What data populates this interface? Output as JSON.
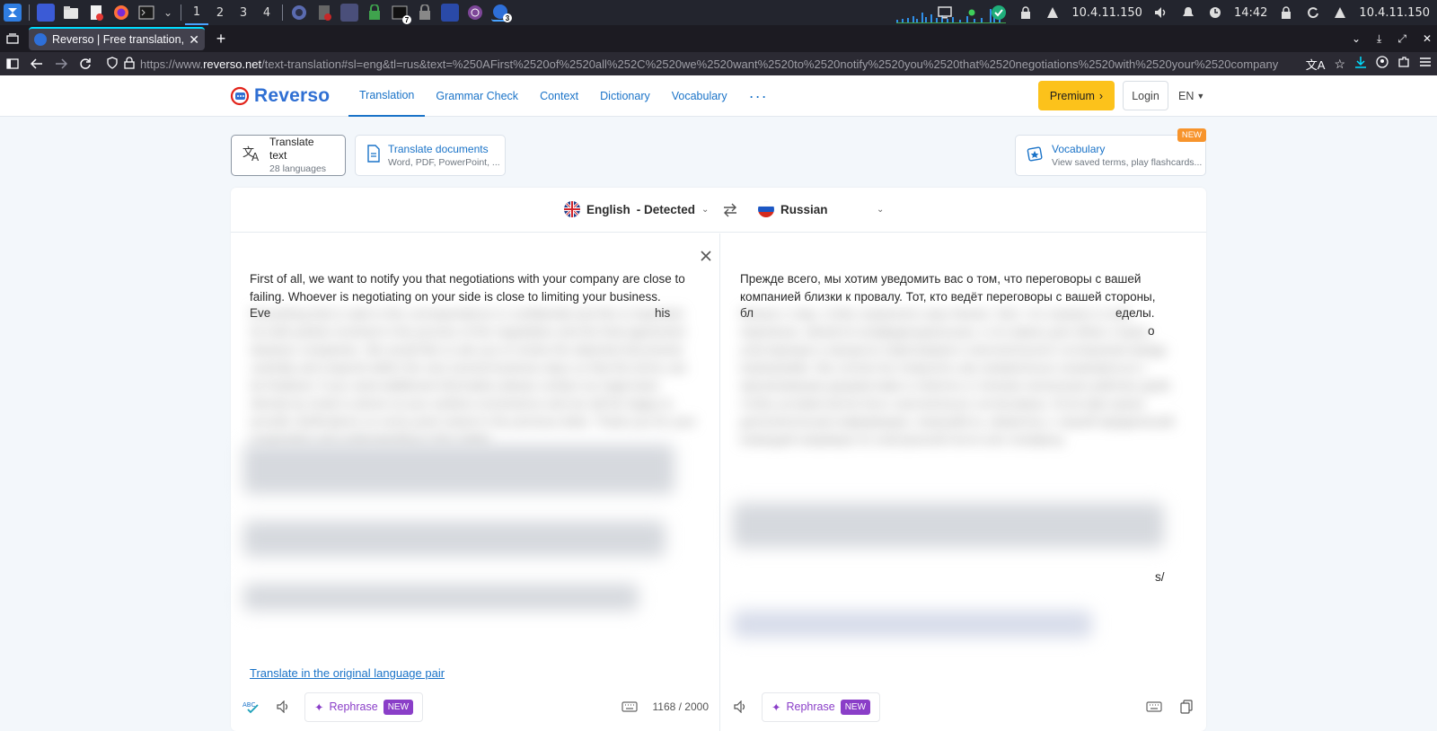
{
  "taskbar": {
    "workspaces": [
      "1",
      "2",
      "3",
      "4"
    ],
    "active_workspace": "1",
    "badges": [
      "7",
      "3"
    ],
    "ip_left": "10.4.11.150",
    "clock": "14:42",
    "ip_right": "10.4.11.150"
  },
  "browser": {
    "tab_title": "Reverso | Free translation, d",
    "url_prefix": "https://www.",
    "url_host": "reverso.net",
    "url_rest": "/text-translation#sl=eng&tl=rus&text=%250AFirst%2520of%2520all%252C%2520we%2520want%2520to%2520notify%2520you%2520that%2520negotiations%2520with%2520your%2520company"
  },
  "site": {
    "logo": "Reverso",
    "nav": [
      "Translation",
      "Grammar Check",
      "Context",
      "Dictionary",
      "Vocabulary"
    ],
    "active_nav": "Translation",
    "premium": "Premium",
    "login": "Login",
    "ui_lang": "EN"
  },
  "features": {
    "translate_text": {
      "title": "Translate text",
      "sub": "28 languages"
    },
    "translate_docs": {
      "title": "Translate documents",
      "sub": "Word, PDF, PowerPoint, ..."
    },
    "vocabulary": {
      "title": "Vocabulary",
      "sub": "View saved terms, play flashcards...",
      "tag": "NEW"
    }
  },
  "translator": {
    "source_lang": "English",
    "source_detected": "- Detected",
    "target_lang": "Russian",
    "source_text_visible": "First of all, we want to notify you that negotiations with your company are close to failing. Whoever is negotiating on your side is close to limiting your business.",
    "source_text_partial": "Eve",
    "source_text_partial_end": "his",
    "source_text_blurred": "Everything that is said in this correspondence is confidential and this is important for both parties involved in the process of the negotiation and the final agreement between companies. We would like to ask you to review the attached documents carefully and respond within the next several business days so that the terms can be finalized. If you need additional information please contact our legal team directly by email or phone at your earliest convenience and we will be happy to provide clarifications on every point raised in the previous letter. Thank you for your cooperation and understanding in this matter.",
    "target_text_visible": "Прежде всего, мы хотим уведомить вас о том, что переговоры с вашей компанией близки к провалу. Тот, кто ведёт переговоры с вашей стороны,",
    "target_text_partial": "бл",
    "target_text_partial_end": "еделы.",
    "target_text_partial_end2": "о",
    "target_text_partial_end3": "s/",
    "target_text_blurred": "близок к тому, чтобы ограничить ваш бизнес. Всё, что сказано в этой переписке, является конфиденциальным, и это важно для обеих сторон, участвующих в процессе переговоров и окончательного соглашения между компаниями. Мы хотели бы попросить вас внимательно ознакомиться с прилагаемыми документами и ответить в течение нескольких рабочих дней, чтобы условия могли быть окончательно согласованы. Если вам нужна дополнительная информация, пожалуйста, свяжитесь с нашей юридической командой напрямую по электронной почте или телефону.",
    "orig_pair_link": "Translate in the original language pair",
    "rephrase": "Rephrase",
    "new_chip": "NEW",
    "char_count": "1168 / 2000"
  },
  "colors": {
    "brand_blue": "#1a73c8",
    "premium_yellow": "#fcc21b",
    "rephrase_purple": "#8a3ec8",
    "new_orange": "#f7942c"
  }
}
